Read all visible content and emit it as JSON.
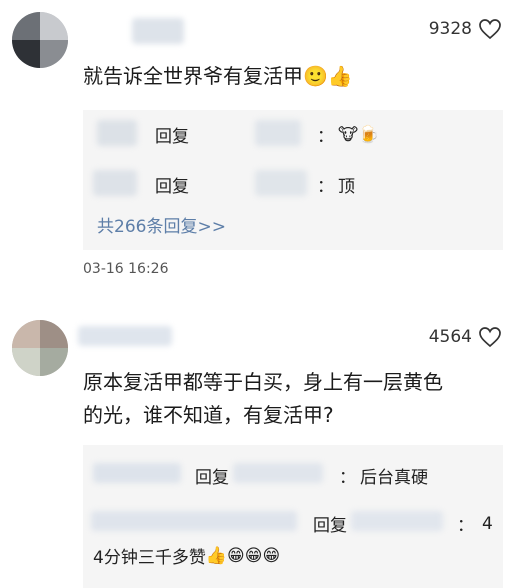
{
  "comments": [
    {
      "like_count": "9328",
      "text_line1": "就告诉全世界爷有复活甲",
      "emoji": [
        "🙂",
        "👍"
      ],
      "replies": [
        {
          "action": "回复",
          "sep": "：",
          "emoji": "🐮🍺"
        },
        {
          "action": "回复",
          "sep": "：",
          "text": "顶"
        }
      ],
      "more_replies": "共266条回复>>",
      "timestamp": "03-16 16:26"
    },
    {
      "like_count": "4564",
      "text_line1": "原本复活甲都等于白买，身上有一层黄色",
      "text_line2": "的光，谁不知道，有复活甲?",
      "replies": [
        {
          "action": "回复",
          "sep": "：",
          "text": "后台真硬"
        },
        {
          "action": "回复",
          "sep": "：",
          "text": "4"
        }
      ],
      "reply_continuation": "4分钟三千多赞",
      "reply_emoji": [
        "👍",
        "😁",
        "😁",
        "😁"
      ]
    }
  ],
  "colors": {
    "link": "#5d7ea8",
    "reply_bg": "#f5f5f5"
  }
}
